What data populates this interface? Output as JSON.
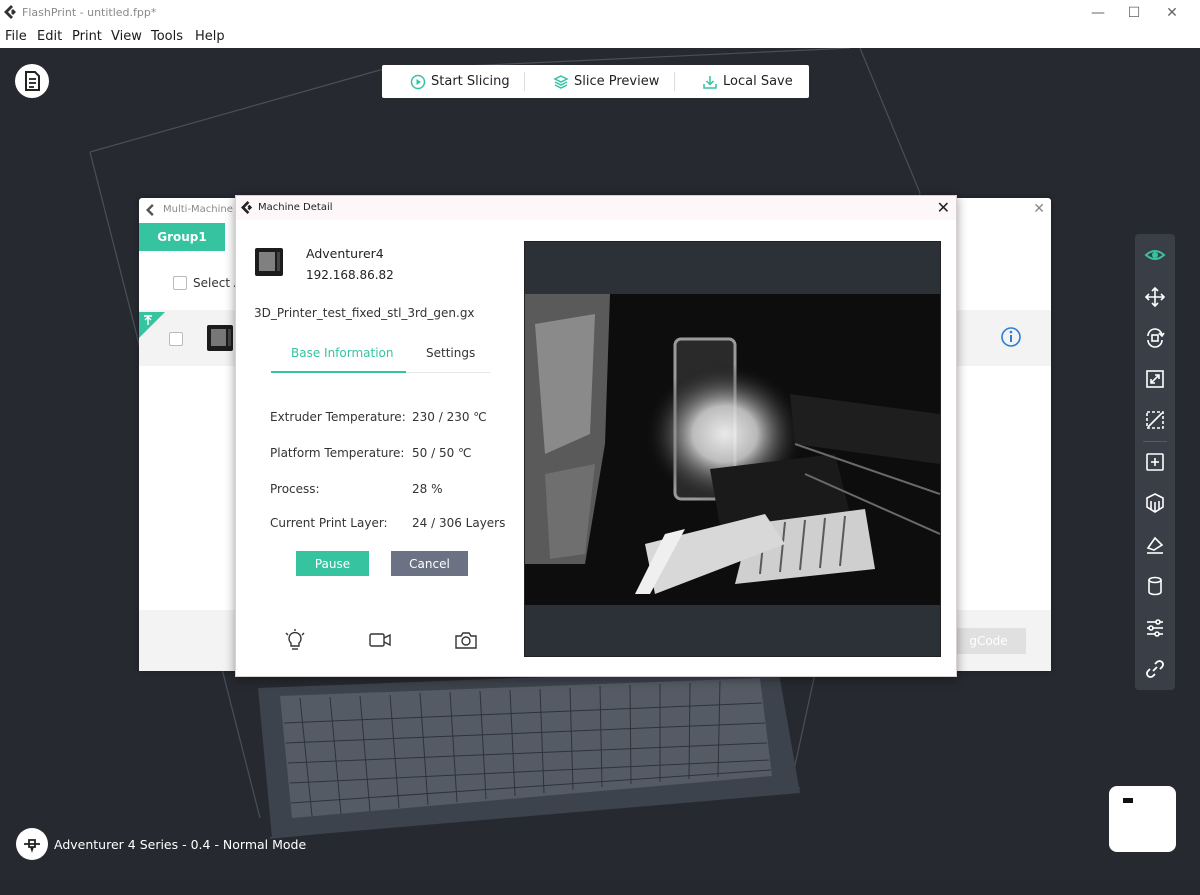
{
  "window": {
    "title": "FlashPrint - untitled.fpp*"
  },
  "menu": [
    "File",
    "Edit",
    "Print",
    "View",
    "Tools",
    "Help"
  ],
  "toolbar": {
    "start_slicing": "Start Slicing",
    "slice_preview": "Slice Preview",
    "local_save": "Local Save"
  },
  "status": {
    "machine_mode": "Adventurer 4 Series - 0.4 - Normal Mode"
  },
  "multi_machine": {
    "title": "Multi-Machine C",
    "group_tab": "Group1",
    "select_all": "Select A",
    "footer_button": "gCode"
  },
  "machine_detail": {
    "title": "Machine Detail",
    "name": "Adventurer4",
    "ip": "192.168.86.82",
    "file": "3D_Printer_test_fixed_stl_3rd_gen.gx",
    "tabs": [
      {
        "label": "Base Information",
        "active": true
      },
      {
        "label": "Settings",
        "active": false
      }
    ],
    "info": [
      {
        "label": "Extruder Temperature:",
        "value": "230 / 230 ℃"
      },
      {
        "label": "Platform Temperature:",
        "value": "50 / 50 ℃"
      },
      {
        "label": "Process:",
        "value": "28 %"
      },
      {
        "label": "Current Print Layer:",
        "value": "24 / 306 Layers"
      }
    ],
    "pause_label": "Pause",
    "cancel_label": "Cancel"
  },
  "colors": {
    "accent": "#36c3a0",
    "cancel": "#6a7283",
    "info_blue": "#2a7fd4"
  },
  "icons": {
    "right_panel": [
      "eye-icon",
      "move-icon",
      "rotate-icon",
      "scale-icon",
      "cut-icon",
      "add-object-icon",
      "supports-icon",
      "paint-icon",
      "cylinder-icon",
      "settings-sliders-icon",
      "link-icon"
    ],
    "bottom": [
      "light-bulb-icon",
      "video-camera-icon",
      "snapshot-camera-icon"
    ]
  }
}
